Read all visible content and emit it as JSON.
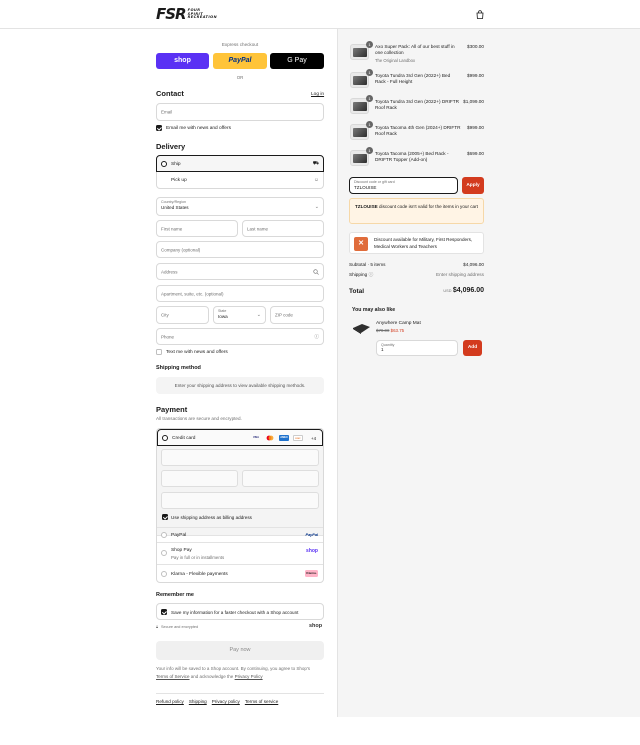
{
  "header": {
    "logo_mark": "FSR",
    "logo_words": [
      "FOUR",
      "SPIRIT",
      "RECREATION"
    ]
  },
  "express": {
    "label": "Express checkout",
    "shop": "shop",
    "paypal": "PayPal",
    "gpay": "G Pay",
    "or": "OR"
  },
  "contact": {
    "title": "Contact",
    "login": "Log in",
    "email_placeholder": "Email",
    "email_offers": "Email me with news and offers"
  },
  "delivery": {
    "title": "Delivery",
    "ship": "Ship",
    "pickup": "Pick up",
    "country_label": "Country/Region",
    "country_value": "United States",
    "first_name": "First name",
    "last_name": "Last name",
    "company": "Company (optional)",
    "address": "Address",
    "apartment": "Apartment, suite, etc. (optional)",
    "city": "City",
    "state_label": "State",
    "state_value": "Iowa",
    "zip": "ZIP code",
    "phone": "Phone",
    "text_offers": "Text me with news and offers"
  },
  "shipping_method": {
    "title": "Shipping method",
    "message": "Enter your shipping address to view available shipping methods."
  },
  "payment": {
    "title": "Payment",
    "subtitle": "All transactions are secure and encrypted.",
    "credit_card": "Credit card",
    "card_more": "+4",
    "billing_same": "Use shipping address as billing address",
    "paypal": "PayPal",
    "shop_pay": "Shop Pay",
    "shop_pay_sub": "Pay in full or in installments",
    "klarna": "Klarna - Flexible payments",
    "paypal_logo": "PayPal",
    "shop_logo": "shop",
    "klarna_logo": "Klarna."
  },
  "remember": {
    "title": "Remember me",
    "save_info": "Save my information for a faster checkout with a Shop account",
    "secure": "Secure and encrypted",
    "shop": "shop"
  },
  "pay_now": "Pay now",
  "legal": {
    "line1": "Your info will be saved to a Shop account. By continuing, you agree to Shop's",
    "terms": "Terms of Service",
    "and_ack": "and acknowledge the",
    "privacy": "Privacy Policy"
  },
  "footer_links": [
    "Refund policy",
    "Shipping",
    "Privacy policy",
    "Terms of service"
  ],
  "cart": {
    "items": [
      {
        "qty": "1",
        "name": "Axo Super Pack: All of our best stuff in one collection",
        "variant": "The Original Landbox",
        "price": "$300.00"
      },
      {
        "qty": "1",
        "name": "Toyota Tundra 3rd Gen (2022+) Bed Rack - Full Height",
        "variant": "",
        "price": "$999.00"
      },
      {
        "qty": "1",
        "name": "Toyota Tundra 3rd Gen (2022+) DRIFTR Roof Rack",
        "variant": "",
        "price": "$1,099.00"
      },
      {
        "qty": "1",
        "name": "Toyota Tacoma 4th Gen (2024+) DRIFTR Roof Rack",
        "variant": "",
        "price": "$999.00"
      },
      {
        "qty": "1",
        "name": "Toyota Tacoma (2005+) Bed Rack - DRIFTR Topper (Add-on)",
        "variant": "",
        "price": "$699.00"
      }
    ],
    "discount_label": "Discount code or gift card",
    "discount_value": "TZLOUISE",
    "apply": "Apply",
    "notice_code": "TZLOUISE",
    "notice_text": "discount code isn't valid for the items in your cart",
    "military": "Discount available for Military, First Responders, Medical Workers and Teachers",
    "subtotal_label": "Subtotal · 5 items",
    "subtotal_value": "$4,096.00",
    "shipping_label": "Shipping",
    "shipping_value": "Enter shipping address",
    "total_label": "Total",
    "currency": "USD",
    "total_value": "$4,096.00",
    "also_like_title": "You may also like",
    "rec_name": "Anywhere Camp Mat",
    "rec_old_price": "$79.00",
    "rec_new_price": "$63.75",
    "rec_qty_label": "Quantity",
    "rec_qty_value": "1",
    "add": "Add"
  }
}
